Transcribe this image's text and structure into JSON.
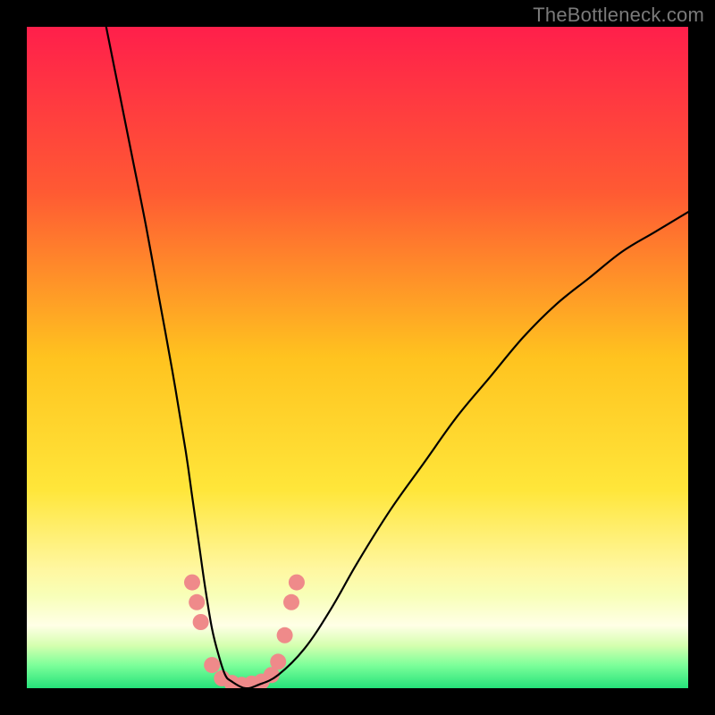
{
  "watermark": "TheBottleneck.com",
  "chart_data": {
    "type": "line",
    "title": "",
    "xlabel": "",
    "ylabel": "",
    "xlim": [
      0,
      100
    ],
    "ylim": [
      0,
      100
    ],
    "grid": false,
    "gradient_stops": [
      {
        "offset": 0,
        "color": "#ff1f4b"
      },
      {
        "offset": 0.25,
        "color": "#ff5a33"
      },
      {
        "offset": 0.5,
        "color": "#ffc31f"
      },
      {
        "offset": 0.7,
        "color": "#ffe63a"
      },
      {
        "offset": 0.82,
        "color": "#fff7a0"
      },
      {
        "offset": 0.86,
        "color": "#f8ffb8"
      },
      {
        "offset": 0.905,
        "color": "#ffffe6"
      },
      {
        "offset": 0.935,
        "color": "#d6ffb0"
      },
      {
        "offset": 0.965,
        "color": "#7dff9a"
      },
      {
        "offset": 1.0,
        "color": "#25e27a"
      }
    ],
    "series": [
      {
        "name": "bottleneck-curve",
        "stroke": "#000000",
        "stroke_width": 2.2,
        "x": [
          12,
          14,
          16,
          18,
          20,
          22,
          24,
          25,
          26,
          27,
          28,
          29,
          30,
          31,
          33,
          35,
          38,
          42,
          46,
          50,
          55,
          60,
          65,
          70,
          75,
          80,
          85,
          90,
          95,
          100
        ],
        "y": [
          100,
          90,
          80,
          70,
          59,
          48,
          36,
          29,
          22,
          15,
          9,
          5,
          2,
          1,
          0,
          0.5,
          2,
          6,
          12,
          19,
          27,
          34,
          41,
          47,
          53,
          58,
          62,
          66,
          69,
          72
        ]
      }
    ],
    "markers": {
      "name": "highlight-dots",
      "fill": "#ef8a8a",
      "radius": 9,
      "points": [
        {
          "x": 25.0,
          "y": 16.0
        },
        {
          "x": 25.7,
          "y": 13.0
        },
        {
          "x": 26.3,
          "y": 10.0
        },
        {
          "x": 28.0,
          "y": 3.5
        },
        {
          "x": 29.5,
          "y": 1.5
        },
        {
          "x": 31.0,
          "y": 0.8
        },
        {
          "x": 32.5,
          "y": 0.5
        },
        {
          "x": 34.0,
          "y": 0.7
        },
        {
          "x": 35.5,
          "y": 1.0
        },
        {
          "x": 37.0,
          "y": 2.0
        },
        {
          "x": 38.0,
          "y": 4.0
        },
        {
          "x": 39.0,
          "y": 8.0
        },
        {
          "x": 40.0,
          "y": 13.0
        },
        {
          "x": 40.8,
          "y": 16.0
        }
      ]
    }
  }
}
